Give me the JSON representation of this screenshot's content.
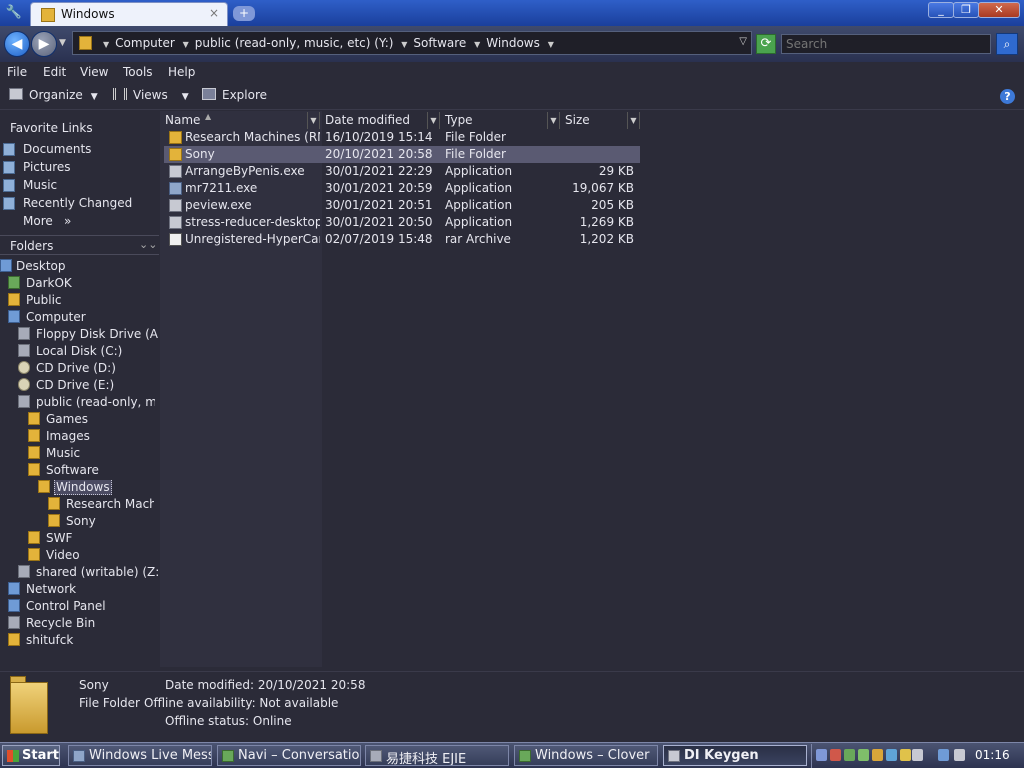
{
  "window": {
    "tab_title": "Windows",
    "tab_close": "×",
    "new_tab": "+",
    "min": "_",
    "max": "❐",
    "close": "✕"
  },
  "address": {
    "crumbs": [
      "Computer",
      "public (read-only, music, etc) (Y:)",
      "Software",
      "Windows"
    ],
    "search_placeholder": "Search"
  },
  "menu": [
    "File",
    "Edit",
    "View",
    "Tools",
    "Help"
  ],
  "toolbar": {
    "organize": "Organize",
    "views": "Views",
    "explore": "Explore"
  },
  "nav": {
    "favorites_header": "Favorite Links",
    "favorites": [
      "Documents",
      "Pictures",
      "Music",
      "Recently Changed",
      "More"
    ],
    "folders_header": "Folders",
    "tree": [
      {
        "label": "Desktop",
        "icon": "desktop-icon"
      },
      {
        "label": "DarkOK",
        "icon": "user-folder-icon"
      },
      {
        "label": "Public",
        "icon": "folder-icon"
      },
      {
        "label": "Computer",
        "icon": "computer-icon"
      },
      {
        "label": "Floppy Disk Drive (A:)",
        "icon": "floppy-icon"
      },
      {
        "label": "Local Disk (C:)",
        "icon": "hard-disk-icon"
      },
      {
        "label": "CD Drive (D:)",
        "icon": "cd-drive-icon"
      },
      {
        "label": "CD Drive (E:)",
        "icon": "cd-drive-icon"
      },
      {
        "label": "public (read-only, music, etc) (Y:)",
        "icon": "network-drive-icon"
      },
      {
        "label": "Games",
        "icon": "folder-icon"
      },
      {
        "label": "Images",
        "icon": "folder-icon"
      },
      {
        "label": "Music",
        "icon": "folder-icon"
      },
      {
        "label": "Software",
        "icon": "folder-icon"
      },
      {
        "label": "Windows",
        "icon": "folder-icon",
        "selected": true
      },
      {
        "label": "Research Machines (RM)",
        "icon": "folder-icon"
      },
      {
        "label": "Sony",
        "icon": "folder-icon"
      },
      {
        "label": "SWF",
        "icon": "folder-icon"
      },
      {
        "label": "Video",
        "icon": "folder-icon"
      },
      {
        "label": "shared (writable) (Z:)",
        "icon": "network-drive-icon"
      },
      {
        "label": "Network",
        "icon": "network-icon"
      },
      {
        "label": "Control Panel",
        "icon": "control-panel-icon"
      },
      {
        "label": "Recycle Bin",
        "icon": "recycle-bin-icon"
      },
      {
        "label": "shitufck",
        "icon": "folder-icon"
      }
    ]
  },
  "list": {
    "columns": [
      "Name",
      "Date modified",
      "Type",
      "Size"
    ],
    "rows": [
      {
        "name": "Research Machines (RM)",
        "date": "16/10/2019 15:14",
        "type": "File Folder",
        "size": "",
        "icon": "folder-icon"
      },
      {
        "name": "Sony",
        "date": "20/10/2021 20:58",
        "type": "File Folder",
        "size": "",
        "icon": "folder-icon",
        "selected": true
      },
      {
        "name": "ArrangeByPenis.exe",
        "date": "30/01/2021 22:29",
        "type": "Application",
        "size": "29 KB",
        "icon": "application-icon"
      },
      {
        "name": "mr7211.exe",
        "date": "30/01/2021 20:59",
        "type": "Application",
        "size": "19,067 KB",
        "icon": "application-icon"
      },
      {
        "name": "peview.exe",
        "date": "30/01/2021 20:51",
        "type": "Application",
        "size": "205 KB",
        "icon": "application-icon"
      },
      {
        "name": "stress-reducer-desktop.exe",
        "date": "30/01/2021 20:50",
        "type": "Application",
        "size": "1,269 KB",
        "icon": "application-icon"
      },
      {
        "name": "Unregistered-HyperCam.rar",
        "date": "02/07/2019 15:48",
        "type": "rar Archive",
        "size": "1,202 KB",
        "icon": "rar-archive-icon"
      }
    ]
  },
  "details": {
    "name": "Sony",
    "kind": "File Folder",
    "date_modified": "Date modified: 20/10/2021 20:58",
    "offline_availability": "Offline availability: Not available",
    "offline_status": "Offline status: Online"
  },
  "taskbar": {
    "start": "Start",
    "tasks": [
      "Windows Live Messenger",
      "Navi – Conversation",
      "易捷科技 EJIE",
      "Windows – Clover",
      "DI Keygen"
    ],
    "active_task": 4,
    "clock": "01:16"
  },
  "colors": {
    "background": "#2b2b38",
    "titlebar": "#2f5fc8",
    "selection": "#5a5a72",
    "folder": "#e3b33a"
  }
}
